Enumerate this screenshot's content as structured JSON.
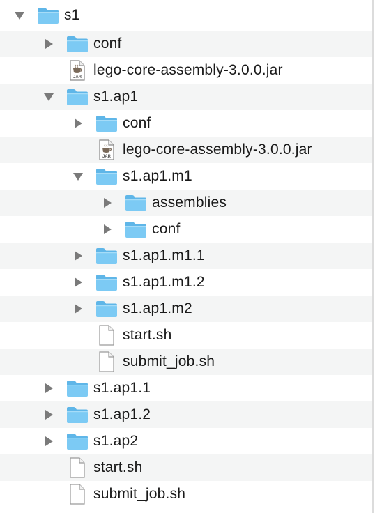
{
  "tree": {
    "rows": [
      {
        "label": "s1",
        "kind": "folder",
        "depth": 0,
        "expander": "open",
        "icon": "folder-icon"
      },
      {
        "label": "conf",
        "kind": "folder",
        "depth": 1,
        "expander": "closed",
        "icon": "folder-icon"
      },
      {
        "label": "lego-core-assembly-3.0.0.jar",
        "kind": "jar",
        "depth": 1,
        "expander": "none",
        "icon": "jar-file-icon"
      },
      {
        "label": "s1.ap1",
        "kind": "folder",
        "depth": 1,
        "expander": "open",
        "icon": "folder-icon"
      },
      {
        "label": "conf",
        "kind": "folder",
        "depth": 2,
        "expander": "closed",
        "icon": "folder-icon"
      },
      {
        "label": "lego-core-assembly-3.0.0.jar",
        "kind": "jar",
        "depth": 2,
        "expander": "none",
        "icon": "jar-file-icon"
      },
      {
        "label": "s1.ap1.m1",
        "kind": "folder",
        "depth": 2,
        "expander": "open",
        "icon": "folder-icon"
      },
      {
        "label": "assemblies",
        "kind": "folder",
        "depth": 3,
        "expander": "closed",
        "icon": "folder-icon"
      },
      {
        "label": "conf",
        "kind": "folder",
        "depth": 3,
        "expander": "closed",
        "icon": "folder-icon"
      },
      {
        "label": "s1.ap1.m1.1",
        "kind": "folder",
        "depth": 2,
        "expander": "closed",
        "icon": "folder-icon"
      },
      {
        "label": "s1.ap1.m1.2",
        "kind": "folder",
        "depth": 2,
        "expander": "closed",
        "icon": "folder-icon"
      },
      {
        "label": "s1.ap1.m2",
        "kind": "folder",
        "depth": 2,
        "expander": "closed",
        "icon": "folder-icon"
      },
      {
        "label": "start.sh",
        "kind": "file",
        "depth": 2,
        "expander": "none",
        "icon": "document-icon"
      },
      {
        "label": "submit_job.sh",
        "kind": "file",
        "depth": 2,
        "expander": "none",
        "icon": "document-icon"
      },
      {
        "label": "s1.ap1.1",
        "kind": "folder",
        "depth": 1,
        "expander": "closed",
        "icon": "folder-icon"
      },
      {
        "label": "s1.ap1.2",
        "kind": "folder",
        "depth": 1,
        "expander": "closed",
        "icon": "folder-icon"
      },
      {
        "label": "s1.ap2",
        "kind": "folder",
        "depth": 1,
        "expander": "closed",
        "icon": "folder-icon"
      },
      {
        "label": "start.sh",
        "kind": "file",
        "depth": 1,
        "expander": "none",
        "icon": "document-icon"
      },
      {
        "label": "submit_job.sh",
        "kind": "file",
        "depth": 1,
        "expander": "none",
        "icon": "document-icon"
      }
    ]
  },
  "colors": {
    "folder_body": "#7ccaf4",
    "folder_tab": "#5fb6e8",
    "disclosure": "#7a7a7a",
    "alt_row": "#f4f5f5"
  },
  "jar_badge": "JAR"
}
